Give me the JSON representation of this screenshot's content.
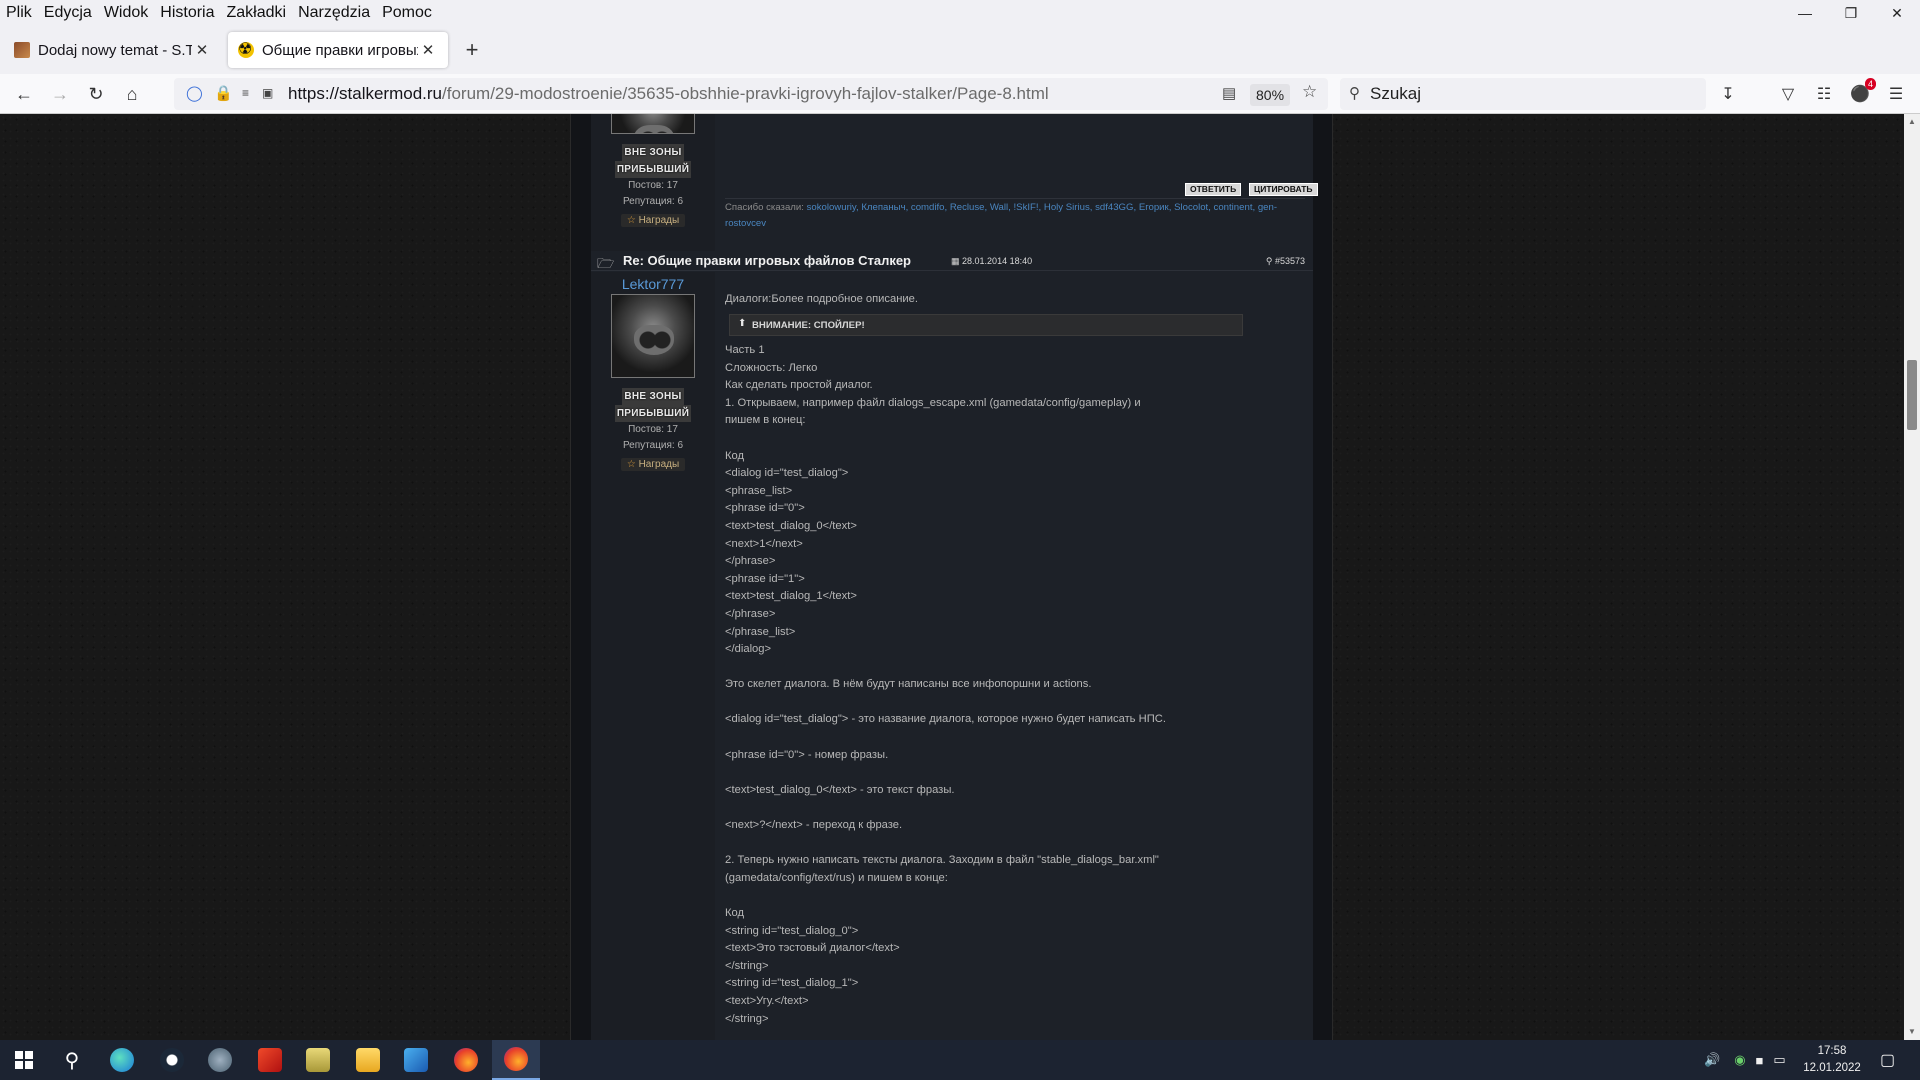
{
  "menu": [
    "Plik",
    "Edycja",
    "Widok",
    "Historia",
    "Zakładki",
    "Narzędzia",
    "Pomoc"
  ],
  "tabs": [
    {
      "title": "Dodaj nowy temat - S.T",
      "active": false
    },
    {
      "title": "Общие правки игровых",
      "active": true
    }
  ],
  "url": {
    "host": "https://stalkermod.ru",
    "path": "/forum/29-modostroenie/35635-obshhie-pravki-igrovyh-fajlov-stalker/Page-8.html"
  },
  "zoom": "80%",
  "search": {
    "placeholder": "Szukaj"
  },
  "extension_badge": "4",
  "prev_post": {
    "rank_line1": "ВНЕ ЗОНЫ",
    "rank_line2": "ПРИБЫВШИЙ",
    "posts": "Постов: 17",
    "reputation": "Репутация: 6",
    "awards": "Награды",
    "reply_button": "ОТВЕТИТЬ",
    "quote_button": "ЦИТИРОВАТЬ",
    "thanks_label": "Спасибо сказали:",
    "thanks_users": [
      "sokolowuriy,",
      "Клепаныч,",
      "comdifo,",
      "Recluse,",
      "Wall,",
      "!SkIF!,",
      "Holy Sirius,",
      "sdf43GG,",
      "Егорик,",
      "Slocolot,",
      "continent,",
      "gen-rostovcev"
    ]
  },
  "post": {
    "title": "Re: Общие правки игровых файлов Сталкер",
    "date": "28.01.2014 18:40",
    "number": "#53573",
    "author": "Lektor777",
    "rank_line1": "ВНЕ ЗОНЫ",
    "rank_line2": "ПРИБЫВШИЙ",
    "posts": "Постов: 17",
    "reputation": "Репутация: 6",
    "awards": "Награды",
    "intro": "Диалоги:Более подробное описание.",
    "spoiler_label": "ВНИМАНИЕ: СПОЙЛЕР!",
    "body": "Часть 1\nСложность: Легко\nКак сделать простой диалог.\n1. Открываем, например файл dialogs_escape.xml (gamedata/config/gameplay) и\nпишем в конец:\n\nКод\n<dialog id=\"test_dialog\">\n<phrase_list>\n<phrase id=\"0\">\n<text>test_dialog_0</text>\n<next>1</next>\n</phrase>\n<phrase id=\"1\">\n<text>test_dialog_1</text>\n</phrase>\n</phrase_list>\n</dialog>\n\nЭто скелет диалога. В нём будут написаны все инфопоршни и actions.\n\n<dialog id=\"test_dialog\"> - это название диалога, которое нужно будет написать НПС.\n\n<phrase id=\"0\"> - номер фразы.\n\n<text>test_dialog_0</text> - это текст фразы.\n\n<next>?</next> - переход к фразе.\n\n2. Теперь нужно написать тексты диалога. Заходим в файл \"stable_dialogs_bar.xml\"\n(gamedata/config/text/rus) и пишем в конце:\n\nКод\n<string id=\"test_dialog_0\">\n<text>Это тэстовый диалог</text>\n</string>\n<string id=\"test_dialog_1\">\n<text>Угу.</text>\n</string>"
  },
  "clock": {
    "time": "17:58",
    "date": "12.01.2022"
  },
  "taskbar_apps": [
    "start",
    "search",
    "edge",
    "steam",
    "app-globe",
    "app-red",
    "notepad",
    "file-explorer",
    "app-blue",
    "firefox",
    "firefox-active"
  ]
}
